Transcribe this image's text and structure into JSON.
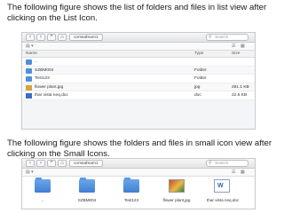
{
  "captions": {
    "list_view": "The following figure shows the list of folders and files in list view after clicking on the List Icon.",
    "icon_view": "The following figure shows the folders and files in small icon view after clicking on the Small Icons."
  },
  "toolbar": {
    "back": "‹",
    "forward": "›",
    "breadcrumb": "comsafearn1",
    "search_placeholder": "Search"
  },
  "list_view": {
    "columns": {
      "name": "Name",
      "type": "Type",
      "size": "Size"
    },
    "rows": [
      {
        "name": "..",
        "type": "",
        "size": "",
        "icon": "folder-up-icon"
      },
      {
        "name": "SZBM004",
        "type": "Folder",
        "size": "",
        "icon": "folder-icon"
      },
      {
        "name": "Test123",
        "type": "Folder",
        "size": "",
        "icon": "folder-icon"
      },
      {
        "name": "flower plant.jpg",
        "type": "jpg",
        "size": "281.1 KB",
        "icon": "image-file-icon"
      },
      {
        "name": "thar vista neq.doc",
        "type": "doc",
        "size": "22.5 KB",
        "icon": "doc-file-icon"
      }
    ]
  },
  "icon_view": {
    "items": [
      {
        "label": "..",
        "icon": "folder-up-icon"
      },
      {
        "label": "SZBM004",
        "icon": "folder-icon"
      },
      {
        "label": "Test123",
        "icon": "folder-icon"
      },
      {
        "label": "flower plant.jpg",
        "icon": "image-file-icon"
      },
      {
        "label": "thar vista neq.doc",
        "icon": "doc-file-icon"
      }
    ]
  },
  "colors": {
    "folder": "#4f8fdc",
    "window_border": "#c6c9ce"
  }
}
